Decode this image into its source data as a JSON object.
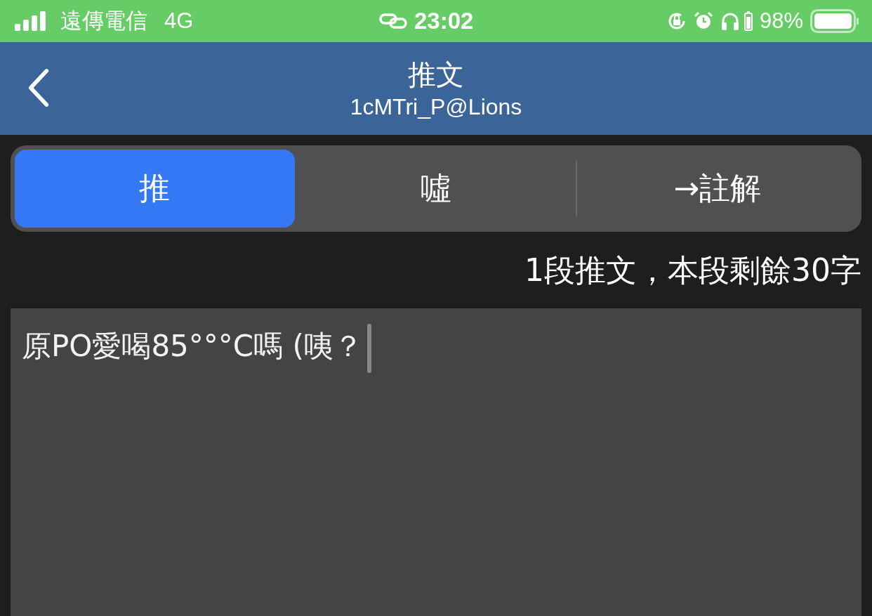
{
  "status_bar": {
    "carrier": "遠傳電信",
    "network": "4G",
    "time": "23:02",
    "battery": "98%"
  },
  "nav_bar": {
    "title": "推文",
    "subtitle": "1cMTri_P@Lions"
  },
  "tabs": [
    {
      "label": "推",
      "selected": true
    },
    {
      "label": "噓",
      "selected": false
    },
    {
      "label": "→註解",
      "selected": false
    }
  ],
  "counter": "1段推文，本段剩餘30字",
  "comment_field": {
    "value": "原PO愛喝85°°°C嗎 (咦？"
  }
}
